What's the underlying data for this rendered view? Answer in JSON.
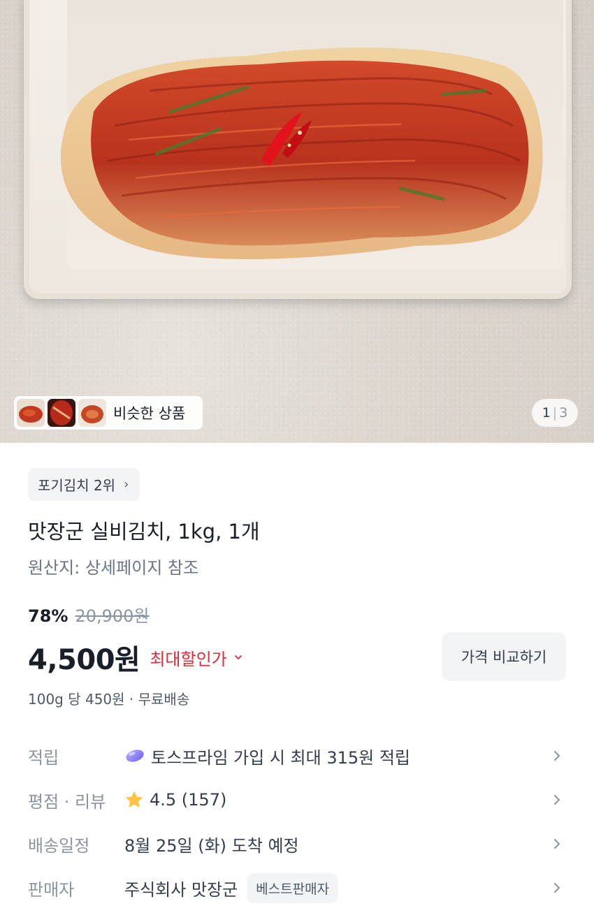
{
  "gallery": {
    "similar_label": "비슷한 상품",
    "page_current": "1",
    "page_separator": "|",
    "page_total": "3"
  },
  "product": {
    "rank_chip": "포기김치 2위",
    "title": "맛장군 실비김치, 1kg, 1개",
    "origin": "원산지: 상세페이지 참조",
    "discount_percent": "78%",
    "original_price": "20,900원",
    "price": "4,500원",
    "max_discount_label": "최대할인가",
    "compare_button": "가격 비교하기",
    "unit_price_shipping": "100g 당 450원 · 무료배송"
  },
  "info_rows": [
    {
      "label": "적립",
      "value": "토스프라임 가입 시 최대 315원 적립",
      "icon": "toss-prime-icon"
    },
    {
      "label": "평점 · 리뷰",
      "value": "4.5 (157)",
      "icon": "star-icon",
      "rating": 4.5,
      "review_count": 157
    },
    {
      "label": "배송일정",
      "value": "8월 25일 (화) 도착 예정"
    },
    {
      "label": "판매자",
      "value": "주식회사 맛장군",
      "badge": "베스트판매자"
    }
  ],
  "colors": {
    "accent_red": "#e42939",
    "text_primary": "#191f28",
    "text_secondary": "#8b95a1",
    "chip_bg": "#f2f4f6",
    "star": "#ffc342",
    "toss_icon": "#8a7dff"
  }
}
